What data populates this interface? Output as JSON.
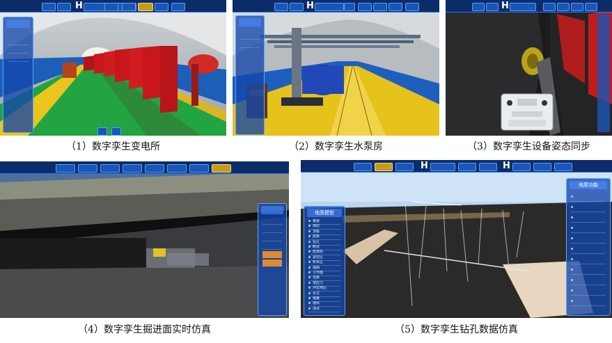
{
  "captions": {
    "p1": "（1）数字孪生变电所",
    "p2": "（2）数字孪生水泵房",
    "p3": "（3）数字孪生设备姿态同步",
    "p4": "（4）数字孪生掘进面实时仿真",
    "p5": "（5）数字孪生钻孔数据仿真"
  },
  "panel5": {
    "left_menu_title": "地质模型",
    "left_menu_items": [
      "巷道",
      "煤层",
      "顶板",
      "底板",
      "钻孔",
      "断层",
      "陷落柱",
      "采空区",
      "积水区",
      "褶曲",
      "工作面",
      "瓦斯",
      "地应力",
      "冲击地压",
      "水文",
      "储量",
      "通风",
      "测点"
    ],
    "right_menu_title": "地质功能",
    "right_menu_items": [
      "",
      "",
      "",
      "",
      "",
      "",
      "",
      "",
      "",
      "",
      ""
    ]
  },
  "colors": {
    "ui_blue": "#1a55b8",
    "ui_border": "#5aa0ff",
    "active_tab": "#c89a1a",
    "floor_green": "#1f9a3b",
    "floor_yellow": "#e8c21d",
    "cabinet_red": "#c8161b"
  },
  "icons": [
    "logo-h-icon",
    "menu-dot-icon",
    "control-panel-icon"
  ]
}
